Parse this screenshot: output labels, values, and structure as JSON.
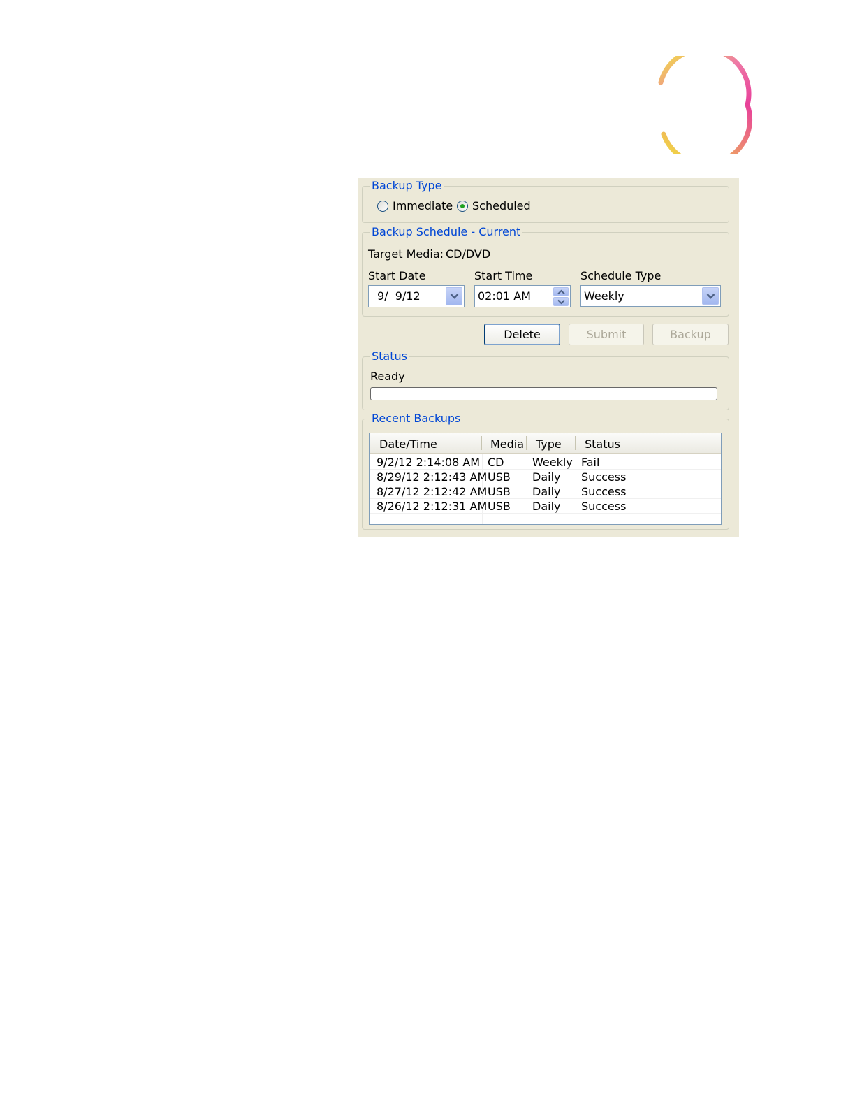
{
  "backup_type": {
    "legend": "Backup Type",
    "options": [
      {
        "label": "Immediate",
        "selected": false
      },
      {
        "label": "Scheduled",
        "selected": true
      }
    ]
  },
  "schedule": {
    "legend": "Backup Schedule - Current",
    "target_media_label": "Target Media:",
    "target_media_value": "CD/DVD",
    "start_date_label": "Start Date",
    "start_date_value": "9/  9/12",
    "start_time_label": "Start Time",
    "start_time_value": "02:01 AM",
    "schedule_type_label": "Schedule Type",
    "schedule_type_value": "Weekly"
  },
  "buttons": {
    "delete": "Delete",
    "submit": "Submit",
    "backup": "Backup"
  },
  "status": {
    "legend": "Status",
    "text": "Ready",
    "progress": 0
  },
  "recent_backups": {
    "legend": "Recent Backups",
    "columns": [
      "Date/Time",
      "Media",
      "Type",
      "Status"
    ],
    "rows": [
      [
        "9/2/12 2:14:08 AM",
        "CD",
        "Weekly",
        "Fail"
      ],
      [
        "8/29/12 2:12:43 AM",
        "USB",
        "Daily",
        "Success"
      ],
      [
        "8/27/12 2:12:42 AM",
        "USB",
        "Daily",
        "Success"
      ],
      [
        "8/26/12 2:12:31 AM",
        "USB",
        "Daily",
        "Success"
      ]
    ]
  },
  "colors": {
    "panel_bg": "#ece9d8",
    "legend_blue": "#0046d5",
    "ring_yellow": "#f2ea3b",
    "ring_pink": "#e8409a"
  },
  "icons": {
    "dropdown": "chevron-down-icon",
    "spin_up": "spin-up-icon",
    "spin_down": "spin-down-icon"
  }
}
